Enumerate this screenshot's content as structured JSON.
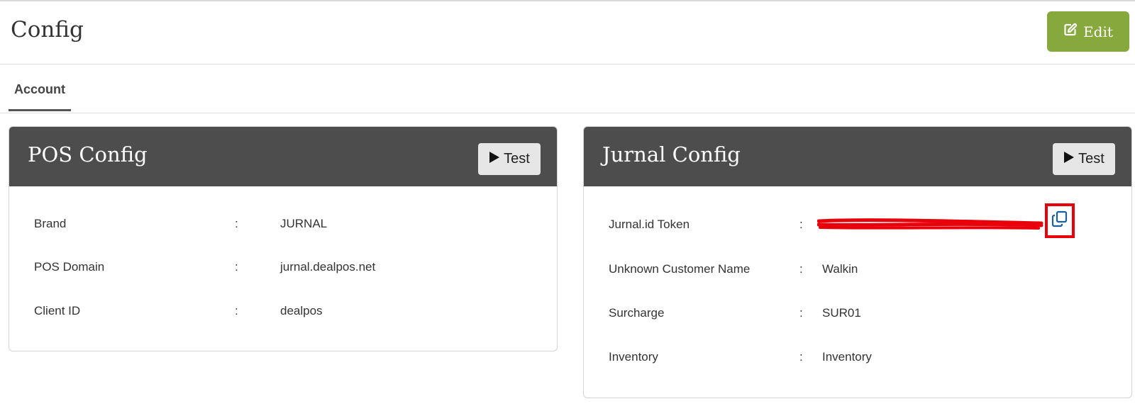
{
  "header": {
    "title": "Config",
    "edit_label": "Edit",
    "edit_color": "#86a83c"
  },
  "tabs": [
    {
      "label": "Account",
      "active": true
    }
  ],
  "pos_config": {
    "title": "POS Config",
    "test_label": "Test",
    "rows": [
      {
        "label": "Brand",
        "sep": ":",
        "value": "JURNAL"
      },
      {
        "label": "POS Domain",
        "sep": ":",
        "value": "jurnal.dealpos.net"
      },
      {
        "label": "Client ID",
        "sep": ":",
        "value": "dealpos"
      }
    ]
  },
  "jurnal_config": {
    "title": "Jurnal Config",
    "test_label": "Test",
    "rows": [
      {
        "label": "Jurnal.id Token",
        "sep": ":",
        "value": ""
      },
      {
        "label": "Unknown Customer Name",
        "sep": ":",
        "value": "Walkin"
      },
      {
        "label": "Surcharge",
        "sep": ":",
        "value": "SUR01"
      },
      {
        "label": "Inventory",
        "sep": ":",
        "value": "Inventory"
      }
    ],
    "token_redacted": true,
    "redaction_color": "#e8000b",
    "copy_icon": "copy-icon"
  },
  "colors": {
    "panel_header": "#4d4d4d",
    "copy_icon": "#1a5fa0"
  }
}
